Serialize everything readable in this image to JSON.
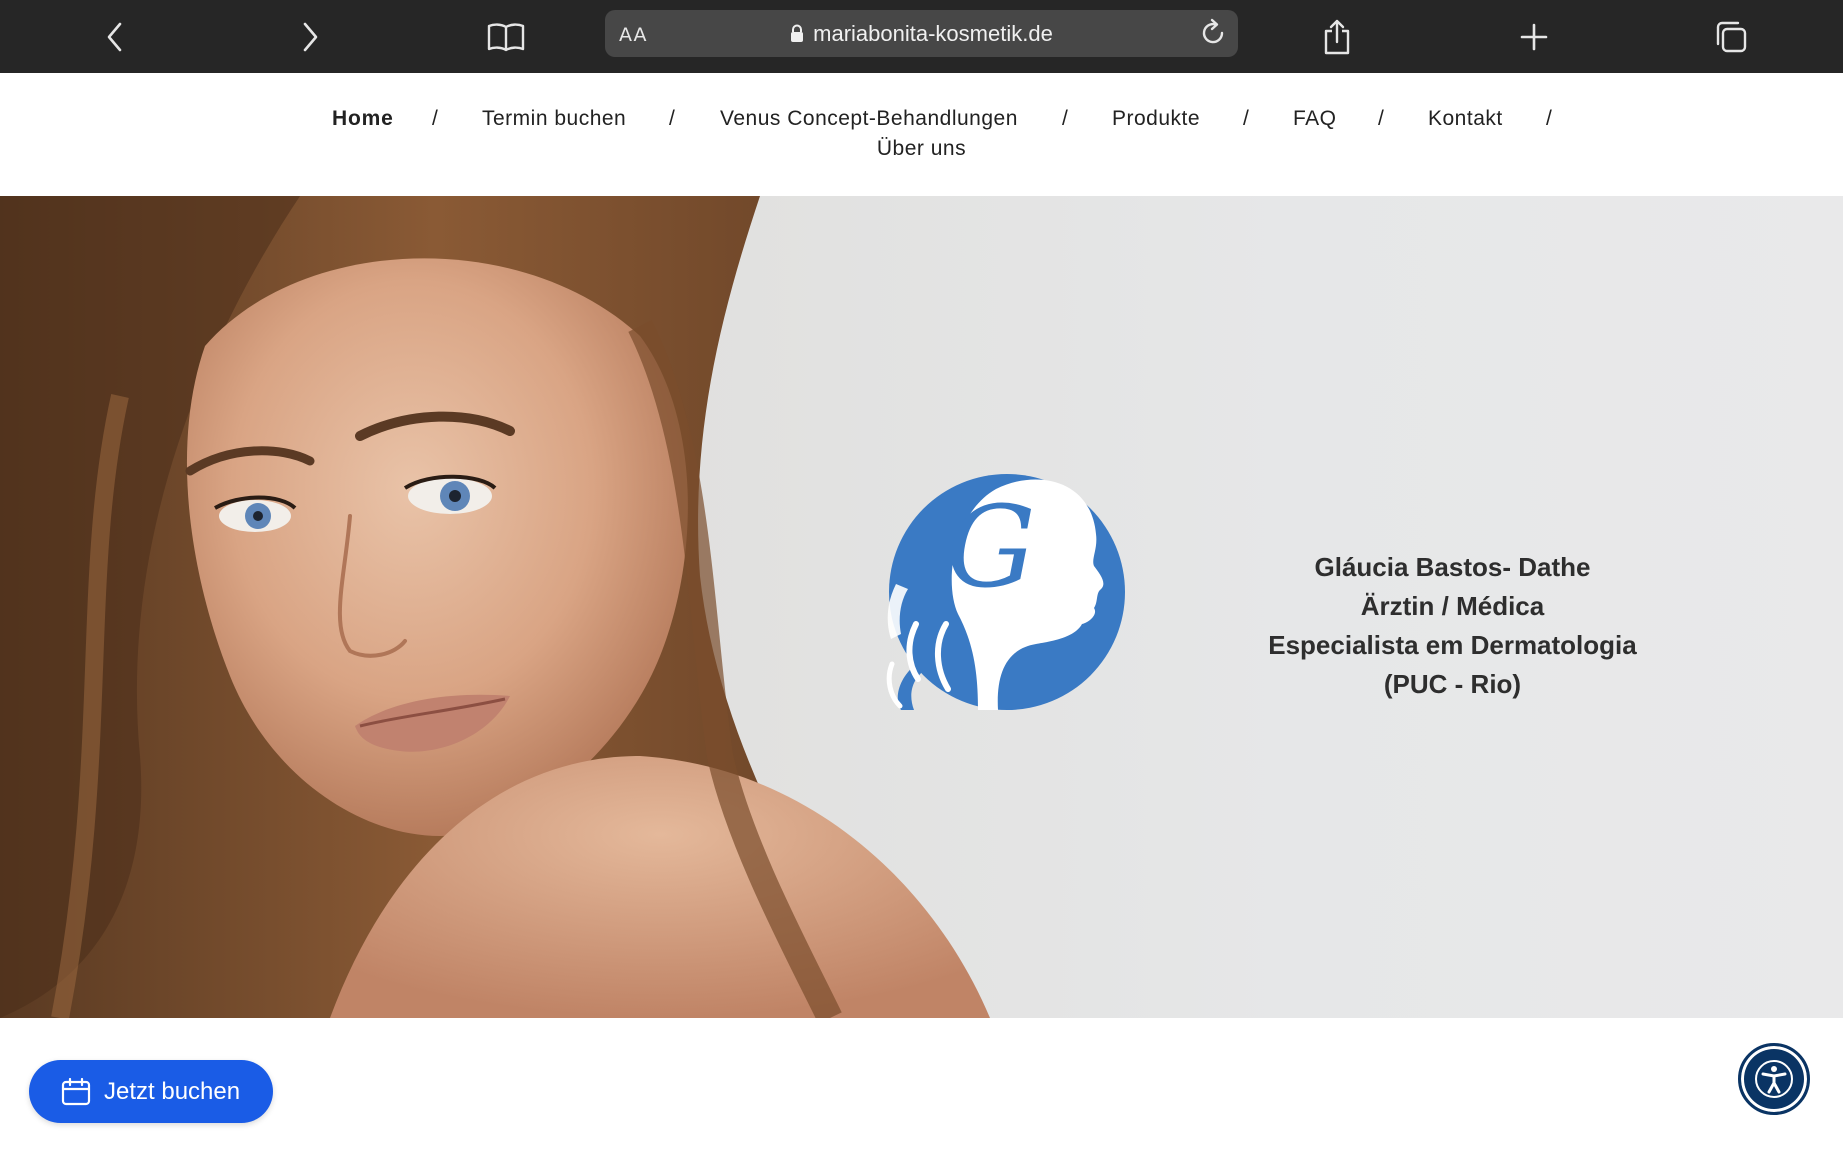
{
  "browser": {
    "text_size_label": "AA",
    "url": "mariabonita-kosmetik.de"
  },
  "nav": {
    "items": [
      {
        "label": "Home",
        "active": true
      },
      {
        "label": "Termin buchen"
      },
      {
        "label": "Venus Concept-Behandlungen"
      },
      {
        "label": "Produkte"
      },
      {
        "label": "FAQ"
      },
      {
        "label": "Kontakt"
      },
      {
        "label": "Über uns"
      }
    ],
    "separator": "/"
  },
  "hero": {
    "name": "Gláucia Bastos- Dathe",
    "title": "Ärztin / Médica",
    "specialty": "Especialista em Dermatologia",
    "institution": "(PUC - Rio)",
    "logo_letter": "G",
    "logo_color": "#3a7ac4"
  },
  "booking_button": {
    "label": "Jetzt buchen",
    "color": "#1a5ce6",
    "icon": "calendar-icon"
  },
  "accessibility_button": {
    "icon": "accessibility-icon",
    "color": "#0a3464"
  }
}
